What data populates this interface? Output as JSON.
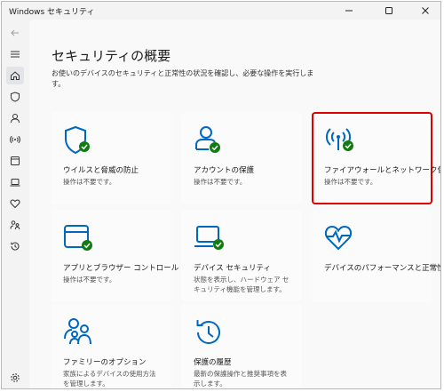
{
  "window": {
    "title": "Windows セキュリティ"
  },
  "page": {
    "title": "セキュリティの概要",
    "description": "お使いのデバイスのセキュリティと正常性の状況を確認し、必要な操作を実行します。"
  },
  "tiles": [
    {
      "name": "ウイルスと脅威の防止",
      "subtitle": "操作は不要です。",
      "icon": "shield-check-icon"
    },
    {
      "name": "アカウントの保護",
      "subtitle": "操作は不要です。",
      "icon": "account-check-icon"
    },
    {
      "name": "ファイアウォールとネットワーク保護",
      "subtitle": "操作は不要です。",
      "icon": "antenna-check-icon"
    },
    {
      "name": "アプリとブラウザー コントロール",
      "subtitle": "操作は不要です。",
      "icon": "app-window-check-icon"
    },
    {
      "name": "デバイス セキュリティ",
      "subtitle": "状態を表示し、ハードウェア セキュリティ機能を管理します。",
      "icon": "laptop-check-icon"
    },
    {
      "name": "デバイスのパフォーマンスと正常性",
      "subtitle": "",
      "icon": "heart-pulse-icon"
    },
    {
      "name": "ファミリーのオプション",
      "subtitle": "家族によるデバイスの使用方法を管理します。",
      "icon": "family-icon"
    },
    {
      "name": "保護の履歴",
      "subtitle": "最新の保護操作と推奨事項を表示します。",
      "icon": "history-icon"
    }
  ],
  "colors": {
    "accent": "#0067c0",
    "check": "#107c10",
    "highlight": "#e00000"
  }
}
